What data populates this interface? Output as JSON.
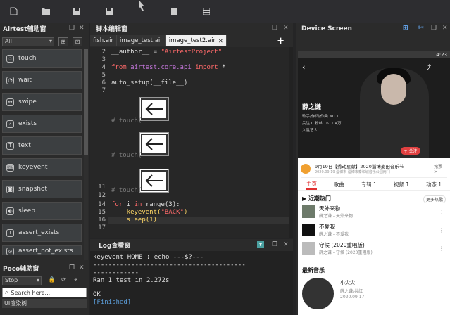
{
  "toolbar": {
    "icons": [
      "new-file-icon",
      "open-folder-icon",
      "save-icon",
      "save-as-icon",
      "cursor-icon",
      "stop-icon",
      "grid-icon"
    ]
  },
  "airtest_panel": {
    "title": "Airtest辅助窗",
    "filter_value": "All",
    "items": [
      {
        "label": "touch",
        "icon": "touch-icon"
      },
      {
        "label": "wait",
        "icon": "clock-icon"
      },
      {
        "label": "swipe",
        "icon": "swipe-icon"
      },
      {
        "label": "exists",
        "icon": "check-icon"
      },
      {
        "label": "text",
        "icon": "text-icon"
      },
      {
        "label": "keyevent",
        "icon": "keyboard-icon"
      },
      {
        "label": "snapshot",
        "icon": "camera-icon"
      },
      {
        "label": "sleep",
        "icon": "sleep-icon"
      },
      {
        "label": "assert_exists",
        "icon": "assert-icon"
      },
      {
        "label": "assert_not_exists",
        "icon": "assert-not-icon"
      }
    ]
  },
  "poco_panel": {
    "title": "Poco辅助窗",
    "mode": "Stop",
    "search_placeholder": "Search here...",
    "tree_root": "UI渲染树"
  },
  "editor": {
    "title": "脚本编辑窗",
    "tabs": [
      {
        "label": "fish.air",
        "active": false
      },
      {
        "label": "image_test.air",
        "active": false
      },
      {
        "label": "image_test2.air",
        "active": true
      }
    ],
    "add_label": "+",
    "lines": {
      "n2": "2",
      "l2a": "__author__ = ",
      "l2b": "\"AirtestProject\"",
      "n3": "3",
      "n4": "4",
      "l4a": "from ",
      "l4b": "airtest.core.api ",
      "l4c": "import",
      "l4d": " *",
      "n5": "5",
      "n6": "6",
      "l6": "auto_setup(__file__)",
      "n7": "7",
      "c1": "# touch(",
      "c2": "# touch(",
      "n11": "11",
      "n12": "12",
      "c3": "# touch(",
      "n14": "14",
      "l14a": "for ",
      "l14b": "i ",
      "l14c": "in ",
      "l14d": "range(3):",
      "n15": "15",
      "l15a": "    keyevent(",
      "l15b": "\"BACK\"",
      "l15c": ")",
      "n16": "16",
      "l16": "    sleep(1)",
      "n17": "17"
    }
  },
  "log": {
    "title": "Log查看窗",
    "lines": [
      "keyevent HOME ; echo ---$?---",
      "----------------------------------------",
      "------------",
      "Ran 1 test in 2.272s",
      "",
      "OK",
      "[Finished]"
    ]
  },
  "device": {
    "title": "Device Screen",
    "status_time": "4:23",
    "artist_name": "薛之谦",
    "artist_sub": "歌手/作词/作曲 NO.1",
    "artist_stats": "关注 0    粉丝 1611.4万",
    "artist_tag": "入驻艺人",
    "follow_label": "+ 关注",
    "banner_title": "9月19日【秀动星献】2020淄博麦田音乐节",
    "banner_sub": "2020.09.19 淄博市 淄博市泰和城音乐公园南门",
    "banner_more": "抢票 >",
    "tabs": [
      "主页",
      "歌曲",
      "专辑 1",
      "视频 1",
      "动态 1"
    ],
    "hot_title": "近期热门",
    "hot_more": "更多热歌",
    "songs": [
      {
        "title": "天外来物",
        "sub": "薛之谦 - 天外来物"
      },
      {
        "title": "不爱我",
        "sub": "薛之谦 - 不爱我"
      },
      {
        "title": "守候 (2020重唱版)",
        "sub": "薛之谦 - 守候 (2020重唱版)"
      }
    ],
    "new_title": "最新音乐",
    "new_song": "小尖尖",
    "new_sub": "薛之谦/共红",
    "new_date": "2020.09.17"
  }
}
